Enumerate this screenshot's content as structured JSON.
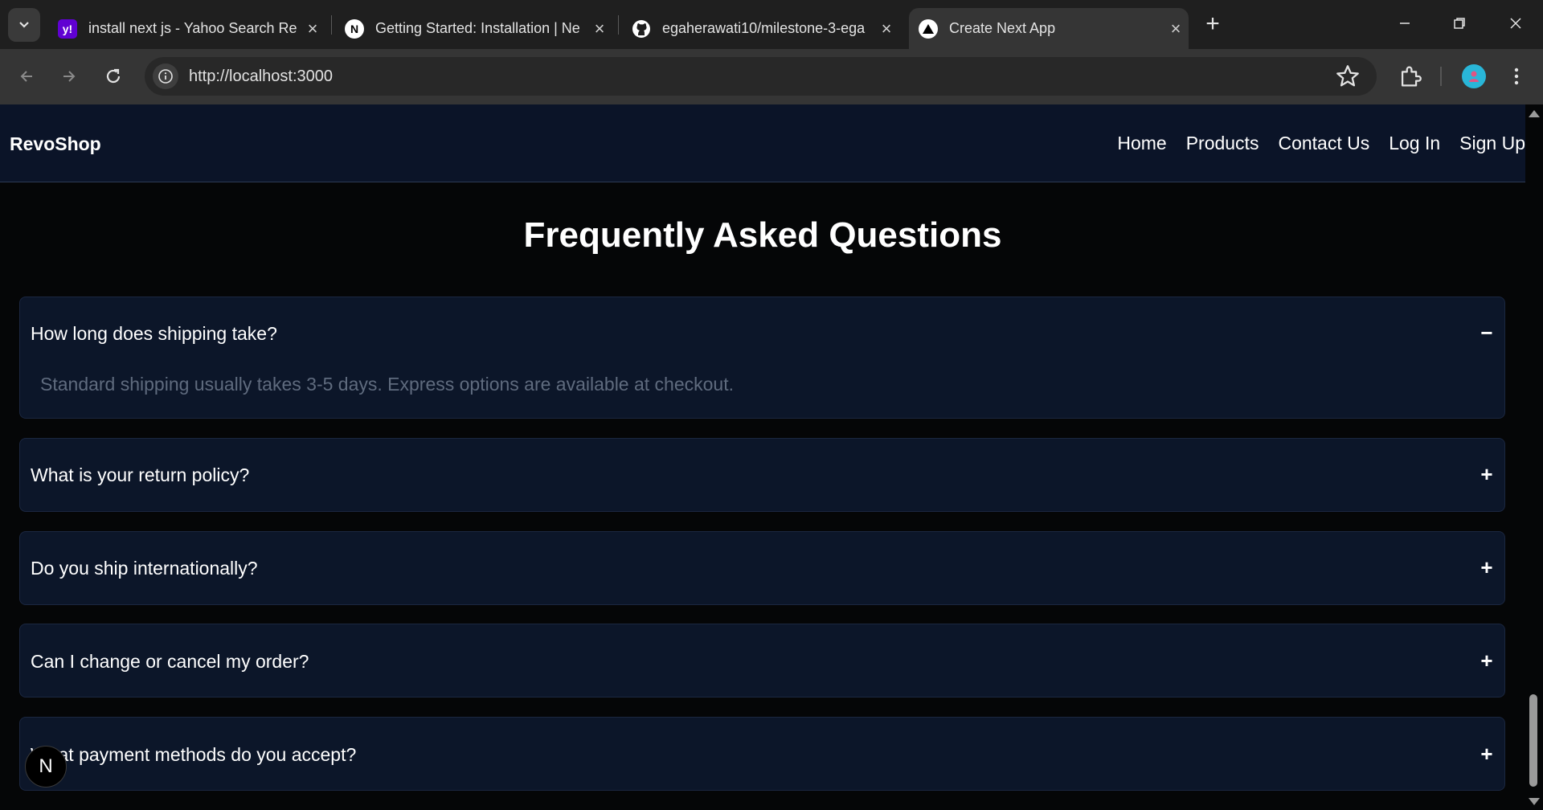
{
  "browser": {
    "tabs": [
      {
        "title": "install next js - Yahoo Search Re",
        "favicon": "yahoo-icon"
      },
      {
        "title": "Getting Started: Installation | Ne",
        "favicon": "nextjs-icon"
      },
      {
        "title": "egaherawati10/milestone-3-ega",
        "favicon": "github-icon"
      },
      {
        "title": "Create Next App",
        "favicon": "vercel-icon"
      }
    ],
    "url": "http://localhost:3000",
    "colors": {
      "chrome": "#1f1f1f",
      "toolbar": "#353535",
      "avatar": "#29b6d8"
    }
  },
  "site": {
    "brand": "RevoShop",
    "nav": [
      "Home",
      "Products",
      "Contact Us",
      "Log In",
      "Sign Up"
    ]
  },
  "faq": {
    "title": "Frequently Asked Questions",
    "items": [
      {
        "question": "How long does shipping take?",
        "toggle": "−",
        "answer": "Standard shipping usually takes 3-5 days. Express options are available at checkout."
      },
      {
        "question": "What is your return policy?",
        "toggle": "+"
      },
      {
        "question": "Do you ship internationally?",
        "toggle": "+"
      },
      {
        "question": "Can I change or cancel my order?",
        "toggle": "+"
      },
      {
        "question": "What payment methods do you accept?",
        "toggle": "+"
      }
    ]
  },
  "dev_badge": "N",
  "colors": {
    "nav_bg": "#0b1428",
    "card_bg": "#0c1629",
    "answer_text": "#5f6b7e",
    "page_bg": "#050607"
  }
}
